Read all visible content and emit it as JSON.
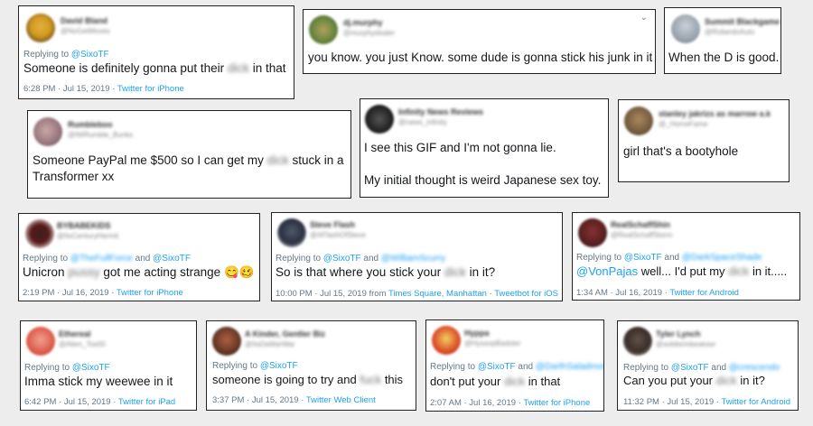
{
  "tweets": [
    {
      "name": "David Bland",
      "handle": "@NoGetMoves",
      "reply_to": "@SixoTF",
      "text_before": "Someone is definitely gonna put their",
      "censored": "dick",
      "text_after": "in that",
      "time": "6:28 PM · Jul 15, 2019 ·",
      "source": "Twitter for iPhone"
    },
    {
      "name": "dj.murphy",
      "handle": "@murphydealer",
      "text": "you know. you just Know. some dude is gonna stick his junk in it"
    },
    {
      "name": "Summit Blackgame",
      "handle": "@RoberdoAuto",
      "text": "When the D is good."
    },
    {
      "name": "Rumbleboo",
      "handle": "@IWRumble_Bunks",
      "line1_before": "Someone PayPal me $500 so I can get my",
      "censored": "dick",
      "line1_after": "stuck in a",
      "line2": "Transformer xx"
    },
    {
      "name": "Infinity News Reviews",
      "handle": "@news_infinity",
      "line1": "I see this GIF and I'm not gonna lie.",
      "line2": "My initial thought is weird Japanese sex toy."
    },
    {
      "name": "stanley jakrizs as marrow a.k",
      "handle": "@_HomeFame",
      "text": "girl that's a bootyhole"
    },
    {
      "name": "BYBABEKIDS",
      "handle": "@ItsCenturyHermit",
      "reply_to": "@TheFullForce",
      "reply_and": "and",
      "reply_to2": "@SixoTF",
      "text_before": "Unicron",
      "censored": "pussy",
      "text_after": "got me acting strange",
      "emojis": "😋🥴",
      "time": "2:19 PM · Jul 16, 2019 ·",
      "source": "Twitter for iPhone"
    },
    {
      "name": "Steve Flash",
      "handle": "@AFlashOfSteve",
      "reply_to": "@SixoTF",
      "reply_and": "and",
      "reply_to2": "@WilliamScurry",
      "text_before": "So is that where you stick your",
      "censored": "dick",
      "text_after": "in it?",
      "time": "10:00 PM · Jul 15, 2019 from",
      "location": "Times Square, Manhattan",
      "sep": "·",
      "source": "Tweetbot for iOS"
    },
    {
      "name": "RealSchaffShin",
      "handle": "@RealSchaffStorm",
      "reply_to": "@SixoTF",
      "reply_and": "and",
      "reply_to2": "@DarkSpaceShade",
      "mention": "@VonPajas",
      "text_before": "well... I'd put my",
      "censored": "dick",
      "text_after": "in it.....",
      "time": "1:34 AM · Jul 16, 2019 ·",
      "source": "Twitter for Android"
    },
    {
      "name": "Ethereal",
      "handle": "@Alien_Tos00",
      "reply_to": "@SixoTF",
      "text": "Imma stick my weewee in it",
      "time": "6:42 PM · Jul 15, 2019 ·",
      "source": "Twitter for iPad"
    },
    {
      "name": "A Kinder, Gentler Biz",
      "handle": "@ItsDaWarWar",
      "reply_to": "@SixoTF",
      "text_before": "someone is going to try and",
      "censored": "fuck",
      "text_after": "this",
      "time": "3:37 PM · Jul 15, 2019 ·",
      "source": "Twitter Web Client"
    },
    {
      "name": "Hyppa",
      "handle": "@HyssopBadster",
      "reply_to": "@SixoTF",
      "reply_and": "and",
      "reply_to2": "@DarthSaladmon",
      "text_before": "don't put your",
      "censored": "dick",
      "text_after": "in that",
      "time": "2:07 AM · Jul 16, 2019 ·",
      "source": "Twitter for iPhone"
    },
    {
      "name": "Tyler Lynch",
      "handle": "@soldierinbeatowr",
      "reply_to": "@SixoTF",
      "reply_and": "and",
      "reply_to2": "@crescendo",
      "text_before": "Can you put your",
      "censored": "dick",
      "text_after": "in it?",
      "time": "11:32 PM · Jul 15, 2019 ·",
      "source": "Twitter for Android"
    }
  ],
  "common": {
    "replying_label": "Replying to",
    "chevron": "⌄"
  },
  "colors": {
    "background": "#ededed",
    "link": "#1da1f2",
    "meta": "#657786",
    "text": "#14171a"
  }
}
